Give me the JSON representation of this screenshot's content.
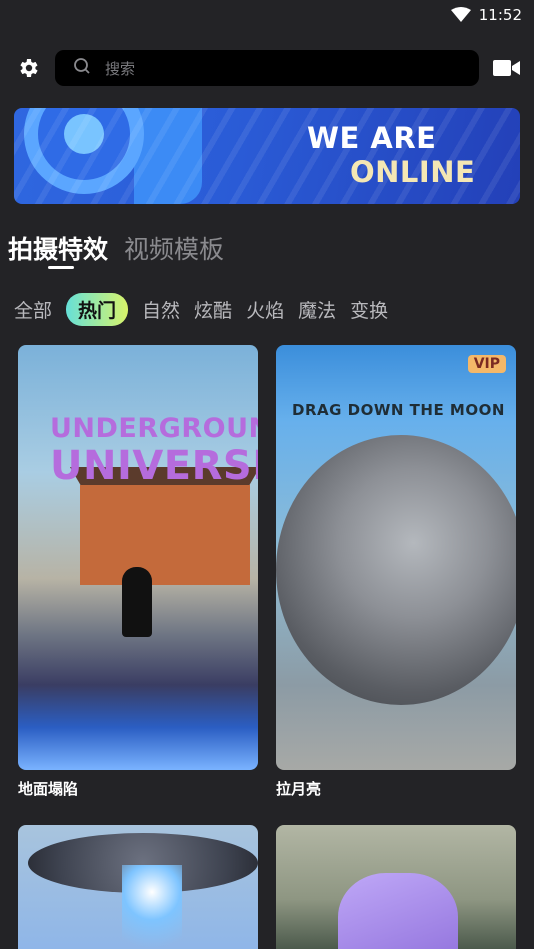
{
  "status_bar": {
    "time": "11:52",
    "wifi_icon": "wifi-icon"
  },
  "top_bar": {
    "settings_icon": "gear-icon",
    "search_placeholder": "搜索",
    "search_icon": "search-icon",
    "camera_icon": "video-camera-icon"
  },
  "banner": {
    "line1": "WE ARE",
    "line2": "ONLINE"
  },
  "main_tabs": [
    {
      "label": "拍摄特效",
      "active": true
    },
    {
      "label": "视频模板",
      "active": false
    }
  ],
  "categories": [
    {
      "label": "全部",
      "active": false
    },
    {
      "label": "热门",
      "active": true
    },
    {
      "label": "自然",
      "active": false
    },
    {
      "label": "炫酷",
      "active": false
    },
    {
      "label": "火焰",
      "active": false
    },
    {
      "label": "魔法",
      "active": false
    },
    {
      "label": "变换",
      "active": false
    }
  ],
  "cards": [
    {
      "title": "地面塌陷",
      "overlay_line1": "UNDERGROUND",
      "overlay_line2": "UNIVERSE",
      "vip": false
    },
    {
      "title": "拉月亮",
      "overlay_line1": "DRAG DOWN THE MOON",
      "vip": true,
      "vip_label": "VIP"
    }
  ],
  "colors": {
    "background": "#232326",
    "chip_active_gradient_start": "#66e0d8",
    "chip_active_gradient_end": "#d8f36a",
    "banner_blue": "#2a5bd6",
    "vip_badge": "#f4b869"
  }
}
